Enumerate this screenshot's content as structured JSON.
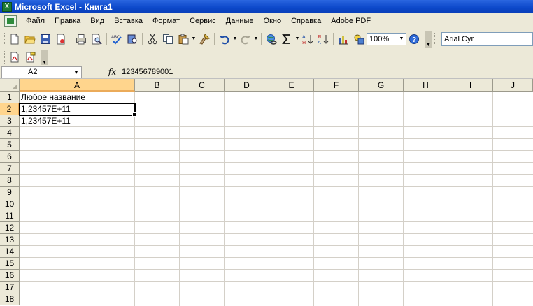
{
  "window": {
    "title": "Microsoft Excel - Книга1"
  },
  "menu": [
    "Файл",
    "Правка",
    "Вид",
    "Вставка",
    "Формат",
    "Сервис",
    "Данные",
    "Окно",
    "Справка",
    "Adobe PDF"
  ],
  "toolbar": {
    "zoom": "100%",
    "font": "Arial Cyr"
  },
  "formula_bar": {
    "name_box": "A2",
    "fx_label": "fx",
    "content": "123456789001"
  },
  "columns": [
    "A",
    "B",
    "C",
    "D",
    "E",
    "F",
    "G",
    "H",
    "I",
    "J"
  ],
  "rows": [
    "1",
    "2",
    "3",
    "4",
    "5",
    "6",
    "7",
    "8",
    "9",
    "10",
    "11",
    "12",
    "13",
    "14",
    "15",
    "16",
    "17",
    "18"
  ],
  "cells": {
    "A1": "Любое название",
    "A2": "1,23457E+11",
    "A3": "1,23457E+11"
  }
}
